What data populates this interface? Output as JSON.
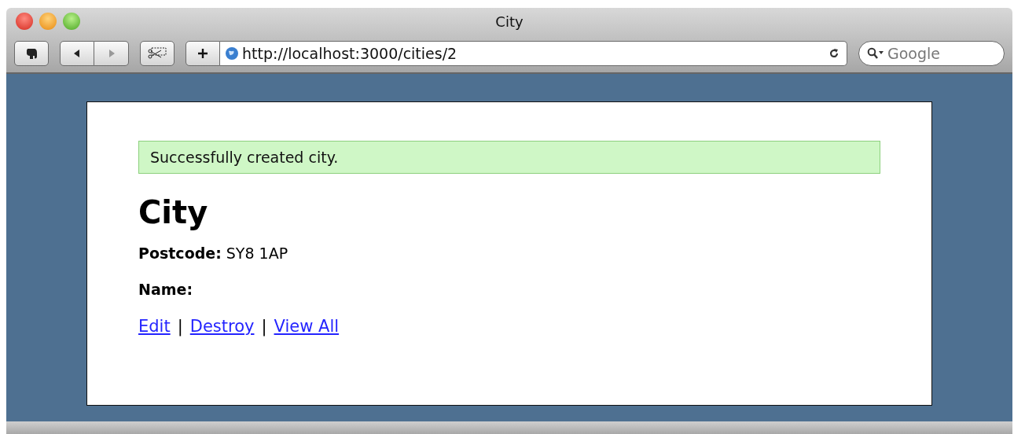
{
  "window": {
    "title": "City"
  },
  "toolbar": {
    "address": "http://localhost:3000/cities/2",
    "search": {
      "placeholder": "Google"
    }
  },
  "page": {
    "flash": "Successfully created city.",
    "heading": "City",
    "fields": [
      {
        "label": "Postcode:",
        "value": "SY8 1AP"
      },
      {
        "label": "Name:"
      }
    ],
    "links": [
      {
        "label": "Edit"
      },
      {
        "label": "Destroy"
      },
      {
        "label": "View All"
      }
    ],
    "separators": [
      "|",
      "|"
    ]
  }
}
